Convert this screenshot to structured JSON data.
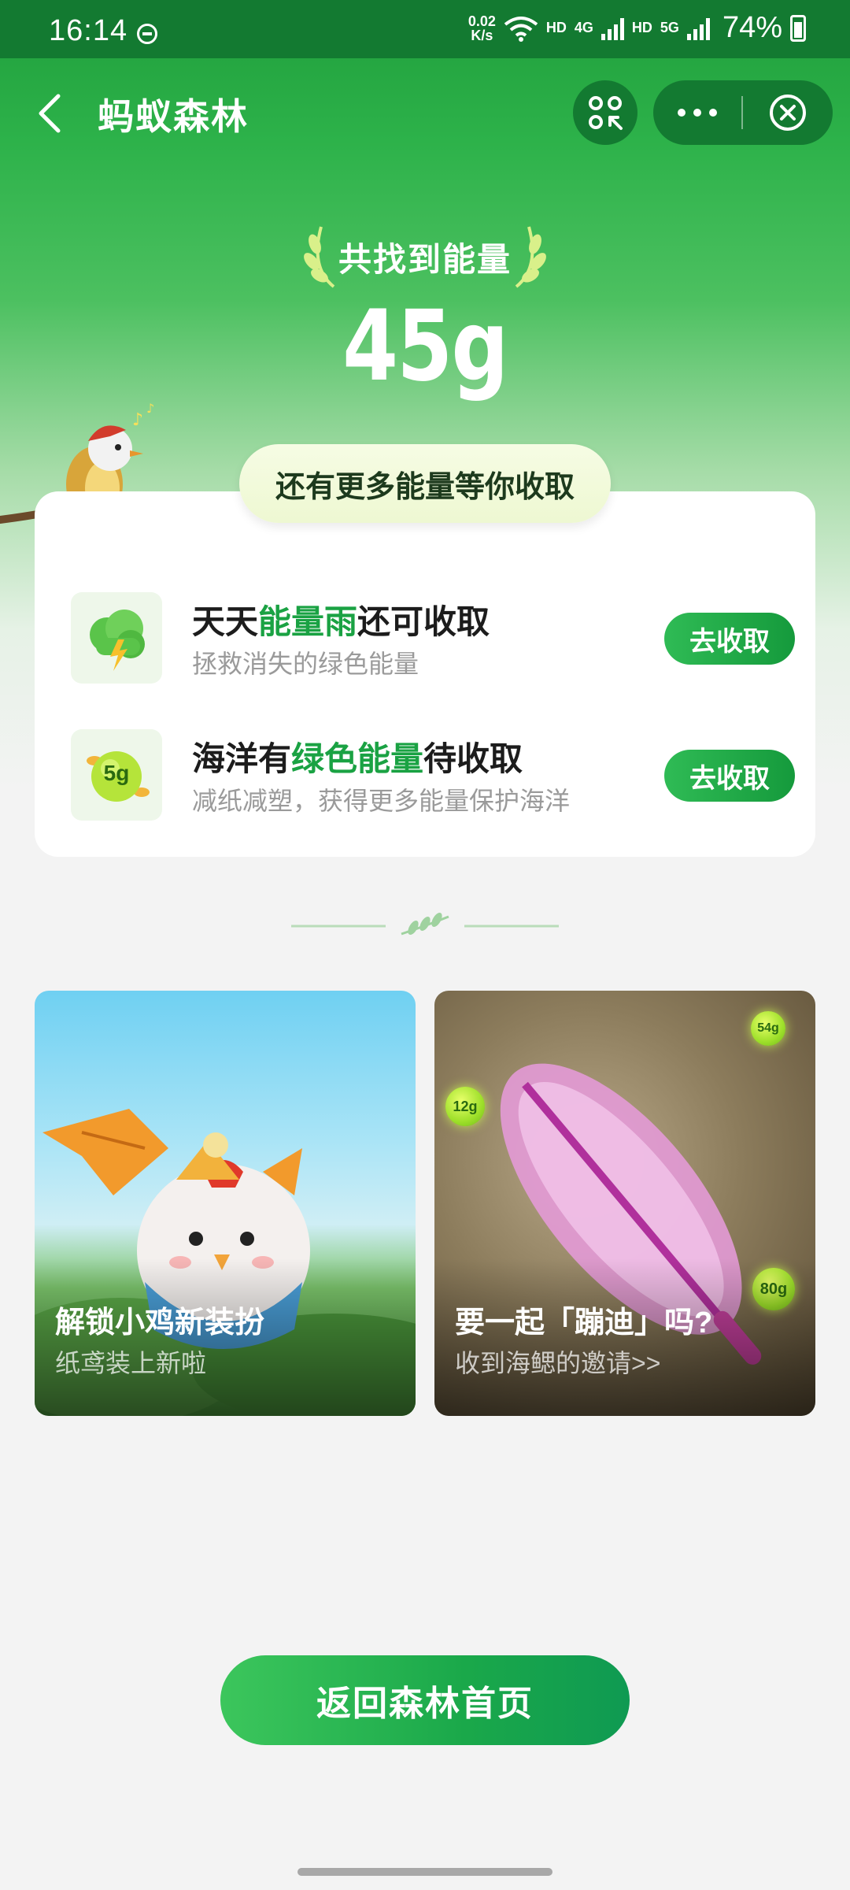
{
  "status_bar": {
    "time": "16:14",
    "net_speed_value": "0.02",
    "net_speed_unit": "K/s",
    "hd1": "HD",
    "sig1": "4G",
    "hd2": "HD",
    "sig2": "5G",
    "battery": "74%"
  },
  "nav": {
    "title": "蚂蚁森林"
  },
  "hero": {
    "label": "共找到能量",
    "value": "45g"
  },
  "card": {
    "pill": "还有更多能量等你收取",
    "tasks": [
      {
        "title_pre": "天天",
        "title_hl": "能量雨",
        "title_post": "还可收取",
        "subtitle": "拯救消失的绿色能量",
        "button": "去收取",
        "icon": "cloud-lightning-icon"
      },
      {
        "title_pre": "海洋有",
        "title_hl": "绿色能量",
        "title_post": "待收取",
        "subtitle": "减纸减塑，获得更多能量保护海洋",
        "button": "去收取",
        "icon": "energy-ball-icon",
        "icon_label": "5g"
      }
    ]
  },
  "promos": [
    {
      "title": "解锁小鸡新装扮",
      "subtitle": "纸鸢装上新啦"
    },
    {
      "title": "要一起「蹦迪」吗?",
      "subtitle": "收到海鳃的邀请>>",
      "balls": [
        "54g",
        "12g",
        "80g"
      ]
    }
  ],
  "bottom_button": "返回森林首页",
  "colors": {
    "brand_green": "#1aa243",
    "status_bar": "#137a31",
    "button_green": "#159a3c"
  }
}
